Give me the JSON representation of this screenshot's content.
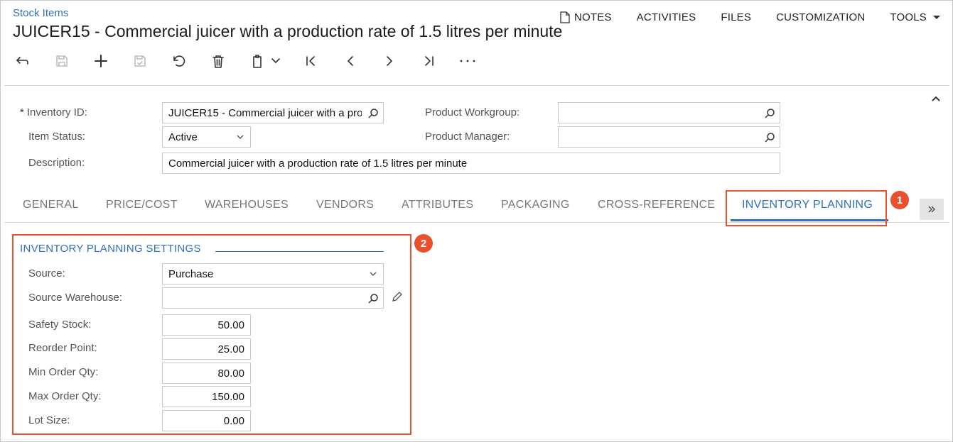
{
  "breadcrumb": "Stock Items",
  "page_title": "JUICER15 - Commercial juicer with a production rate of 1.5 litres per minute",
  "top_menu": {
    "notes": "NOTES",
    "activities": "ACTIVITIES",
    "files": "FILES",
    "customization": "CUSTOMIZATION",
    "tools": "TOOLS"
  },
  "toolbar": {
    "icons": [
      "back-icon",
      "save-icon",
      "add-icon",
      "save-as-icon",
      "undo-icon",
      "delete-icon",
      "copy-paste-icon",
      "first-record-icon",
      "previous-record-icon",
      "next-record-icon",
      "last-record-icon",
      "more-icon"
    ],
    "disabled": [
      "save-icon",
      "save-as-icon"
    ]
  },
  "summary": {
    "inventory_id": {
      "label": "Inventory ID:",
      "required_mark": "*",
      "value": "JUICER15 - Commercial juicer with a production rate of 1.5 litres per minute"
    },
    "item_status": {
      "label": "Item Status:",
      "value": "Active"
    },
    "description": {
      "label": "Description:",
      "value": "Commercial juicer with a production rate of 1.5 litres per minute"
    },
    "product_workgroup": {
      "label": "Product Workgroup:",
      "value": ""
    },
    "product_manager": {
      "label": "Product Manager:",
      "value": ""
    }
  },
  "tabs": [
    {
      "label": "GENERAL"
    },
    {
      "label": "PRICE/COST"
    },
    {
      "label": "WAREHOUSES"
    },
    {
      "label": "VENDORS"
    },
    {
      "label": "ATTRIBUTES"
    },
    {
      "label": "PACKAGING"
    },
    {
      "label": "CROSS-REFERENCE"
    },
    {
      "label": "INVENTORY PLANNING"
    }
  ],
  "active_tab": "INVENTORY PLANNING",
  "callouts": {
    "one": "1",
    "two": "2"
  },
  "planning": {
    "section_title": "INVENTORY PLANNING SETTINGS",
    "source": {
      "label": "Source:",
      "value": "Purchase"
    },
    "source_warehouse": {
      "label": "Source Warehouse:",
      "value": ""
    },
    "safety_stock": {
      "label": "Safety Stock:",
      "value": "50.00"
    },
    "reorder_point": {
      "label": "Reorder Point:",
      "value": "25.00"
    },
    "min_order_qty": {
      "label": "Min Order Qty:",
      "value": "80.00"
    },
    "max_order_qty": {
      "label": "Max Order Qty:",
      "value": "150.00"
    },
    "lot_size": {
      "label": "Lot Size:",
      "value": "0.00"
    }
  },
  "colors": {
    "accent": "#2f6fbf",
    "callout": "#e8502e"
  }
}
